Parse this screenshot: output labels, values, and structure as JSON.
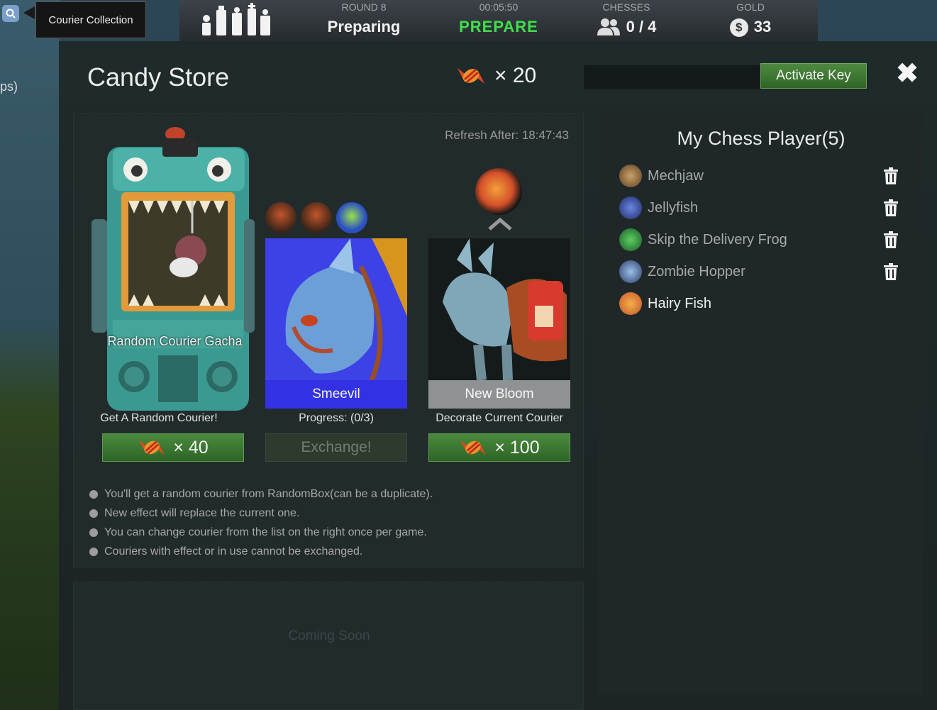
{
  "background": {
    "left_partial_text": "ps)"
  },
  "courier_collection": {
    "tooltip": "Courier Collection",
    "icon": "search-icon"
  },
  "topbar": {
    "round": {
      "label": "ROUND 8",
      "value": "Preparing"
    },
    "timer": {
      "label": "00:05:50",
      "value": "PREPARE",
      "color": "#3fe04b"
    },
    "chesses": {
      "label": "CHESSES",
      "value": "0 / 4",
      "icon": "people-icon"
    },
    "gold": {
      "label": "GOLD",
      "value": "33",
      "icon": "dollar-coin-icon",
      "symbol": "$"
    }
  },
  "dialog": {
    "title": "Candy Store",
    "candy_count": "× 20",
    "key_input": {
      "value": "",
      "placeholder": ""
    },
    "activate_label": "Activate Key",
    "close_icon": "close-icon"
  },
  "store": {
    "refresh_text": "Refresh After: 18:47:43",
    "gacha": {
      "name": "Random Courier Gacha",
      "caption": "Get A Random Courier!",
      "price": "× 40"
    },
    "exchange": {
      "name": "Smeevil",
      "caption": "Progress: (0/3)",
      "button": "Exchange!"
    },
    "decorate": {
      "name": "New Bloom",
      "caption": "Decorate Current Courier",
      "price": "× 100"
    },
    "notes": [
      "You'll get a random courier from RandomBox(can be a duplicate).",
      "New effect will replace the current one.",
      "You can change courier from the list on the right once per game.",
      "Couriers with effect or in use cannot be exchanged."
    ],
    "coming_soon": "Coming Soon"
  },
  "chess_players": {
    "title": "My Chess Player(5)",
    "items": [
      {
        "name": "Mechjaw",
        "color": "#8b6b3e",
        "deletable": true
      },
      {
        "name": "Jellyfish",
        "color": "#4a62b8",
        "deletable": true
      },
      {
        "name": "Skip the Delivery Frog",
        "color": "#3f8b48",
        "deletable": true
      },
      {
        "name": "Zombie Hopper",
        "color": "#5878b0",
        "deletable": true
      },
      {
        "name": "Hairy Fish",
        "color": "#d9883f",
        "deletable": false
      }
    ]
  }
}
